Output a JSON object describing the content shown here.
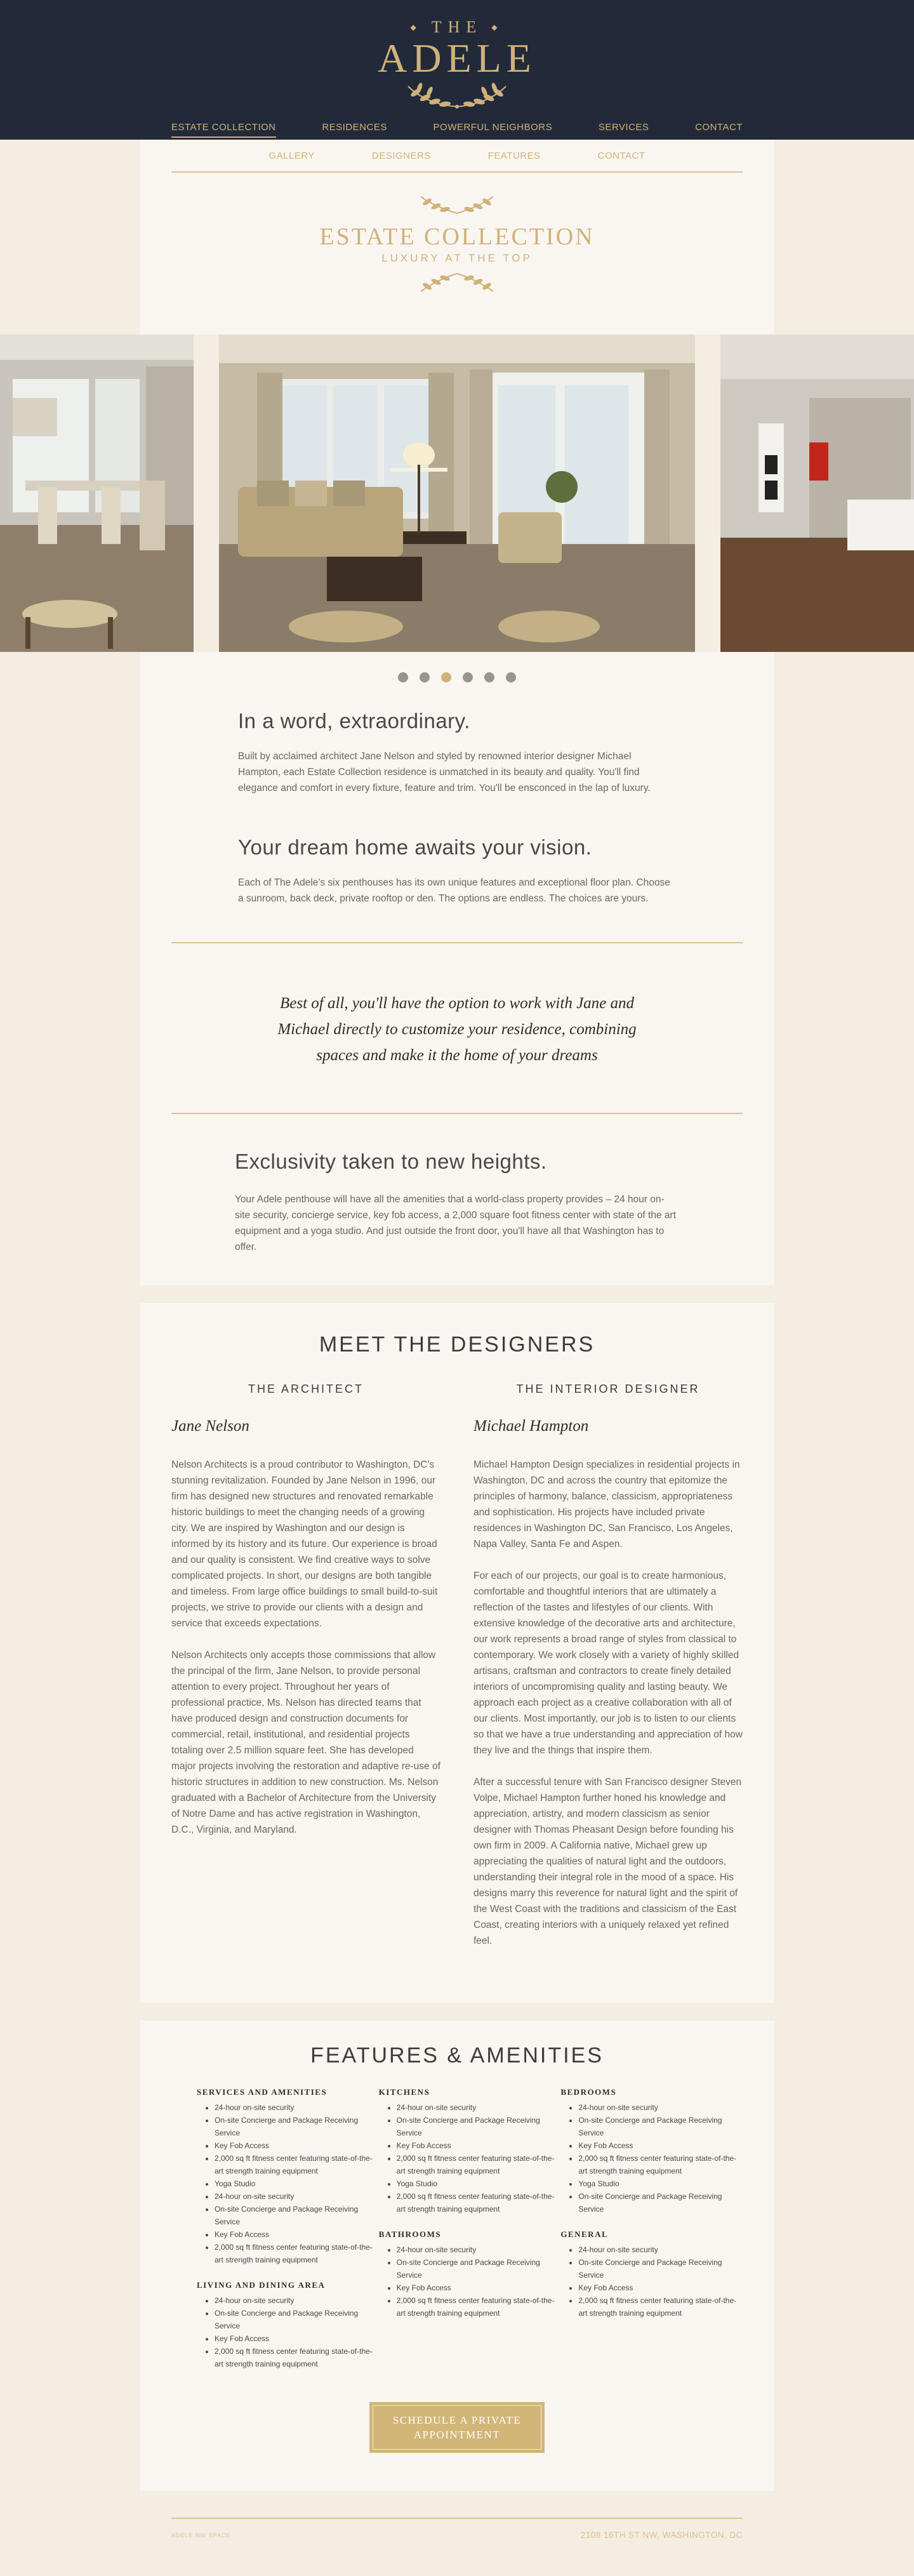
{
  "brand": {
    "the": "THE",
    "name": "ADELE"
  },
  "main_nav": [
    {
      "label": "ESTATE COLLECTION",
      "active": true
    },
    {
      "label": "RESIDENCES"
    },
    {
      "label": "POWERFUL NEIGHBORS"
    },
    {
      "label": "SERVICES"
    },
    {
      "label": "CONTACT"
    }
  ],
  "sub_nav": [
    "GALLERY",
    "DESIGNERS",
    "FEATURES",
    "CONTACT"
  ],
  "hero": {
    "title": "ESTATE COLLECTION",
    "subtitle": "LUXURY AT THE TOP"
  },
  "carousel": {
    "slide_count": 6,
    "active_index": 2
  },
  "intro": [
    {
      "heading": "In a word, extraordinary.",
      "body": "Built by acclaimed architect Jane Nelson and styled by renowned interior designer Michael Hampton, each Estate Collection residence is unmatched in its beauty and quality. You'll find elegance and comfort in every fixture, feature and trim. You'll be ensconced in the lap of luxury."
    },
    {
      "heading": "Your dream home awaits your vision.",
      "body": "Each of The Adele's six penthouses has its own unique features and exceptional floor plan. Choose a sunroom, back deck, private rooftop or den. The options are endless. The choices are yours."
    }
  ],
  "quote": "Best of all, you'll have the option to work with Jane and Michael directly to customize your residence, combining spaces and make it the home of your dreams",
  "exclusivity": {
    "heading": "Exclusivity taken to new heights.",
    "body": "Your Adele penthouse will have all the amenities that a world-class property provides – 24 hour on-site security, concierge service, key fob access, a 2,000 square foot fitness center with state of the art equipment and a yoga studio. And just outside the front door, you'll have all that Washington has to offer."
  },
  "designers": {
    "title": "MEET THE DESIGNERS",
    "architect": {
      "role": "THE ARCHITECT",
      "name": "Jane Nelson",
      "paragraphs": [
        "Nelson Architects is a proud contributor to Washington, DC's stunning revitalization. Founded by Jane Nelson in 1996, our firm has designed new structures and renovated remarkable historic buildings to meet the changing needs of a growing city. We are inspired by Washington and our design is informed by its history and its future. Our experience is broad and our quality is consistent. We find creative ways to solve complicated projects. In short, our designs are both tangible and timeless. From large office buildings to small build-to-suit projects, we strive to provide our clients with a design and service that exceeds expectations.",
        "Nelson Architects only accepts those commissions that allow the principal of the firm, Jane Nelson, to provide personal attention to every project. Throughout her years of professional practice, Ms. Nelson has directed teams that have produced design and construction documents for commercial, retail, institutional, and residential projects totaling over 2.5 million square feet. She has developed major projects involving the restoration and adaptive re-use of historic structures in addition to new construction. Ms. Nelson graduated with a Bachelor of Architecture from the University of Notre Dame and has active registration in Washington, D.C., Virginia, and Maryland."
      ]
    },
    "interior": {
      "role": "THE INTERIOR DESIGNER",
      "name": "Michael Hampton",
      "paragraphs": [
        "Michael Hampton Design specializes in residential projects in Washington, DC and across the country that epitomize the principles of harmony, balance, classicism, appropriateness and sophistication. His projects have included private residences in Washington DC, San Francisco, Los Angeles, Napa Valley, Santa Fe and Aspen.",
        "For each of our projects, our goal is to create harmonious, comfortable and thoughtful interiors that are ultimately a reflection of the tastes and lifestyles of our clients. With extensive knowledge of the decorative arts and architecture, our work represents a broad range of styles from classical to contemporary. We work closely with a variety of highly skilled artisans, craftsman and contractors to create finely detailed interiors of uncompromising quality and lasting beauty. We approach each project as a creative collaboration with all of our clients. Most importantly, our job is to listen to our clients so that we have a true understanding and appreciation of how they live and the things that inspire them.",
        "After a successful tenure with San Francisco designer Steven Volpe, Michael Hampton further honed his knowledge and appreciation, artistry, and modern classicism as senior designer with Thomas Pheasant Design before founding his own firm in 2009. A California native, Michael grew up appreciating the qualities of natural light and the outdoors, understanding their integral role in the mood of a space. His designs marry this reverence for natural light and the spirit of the West Coast with the traditions and classicism of the East Coast, creating interiors with a uniquely relaxed yet refined feel."
      ]
    }
  },
  "features": {
    "title": "FEATURES & AMENITIES",
    "columns": [
      [
        {
          "heading": "SERVICES AND AMENITIES",
          "items": [
            "24-hour on-site security",
            "On-site Concierge and Package Receiving Service",
            "Key Fob Access",
            "2,000 sq ft fitness center featuring state-of-the-art strength training equipment",
            "Yoga Studio",
            "24-hour on-site security",
            "On-site Concierge and Package Receiving Service",
            "Key Fob Access",
            "2,000 sq ft fitness center featuring state-of-the-art strength training equipment"
          ]
        },
        {
          "heading": "LIVING AND DINING AREA",
          "items": [
            "24-hour on-site security",
            "On-site Concierge and Package Receiving Service",
            "Key Fob Access",
            "2,000 sq ft fitness center featuring state-of-the-art strength training equipment"
          ]
        }
      ],
      [
        {
          "heading": "KITCHENS",
          "items": [
            "24-hour on-site security",
            "On-site Concierge and Package Receiving Service",
            "Key Fob Access",
            "2,000 sq ft fitness center featuring state-of-the-art strength training equipment",
            "Yoga Studio",
            "2,000 sq ft fitness center featuring state-of-the-art strength training equipment"
          ]
        },
        {
          "heading": "BATHROOMS",
          "items": [
            "24-hour on-site security",
            "On-site Concierge and Package Receiving Service",
            "Key Fob Access",
            "2,000 sq ft fitness center featuring state-of-the-art strength training equipment"
          ]
        }
      ],
      [
        {
          "heading": "BEDROOMS",
          "items": [
            "24-hour on-site security",
            "On-site Concierge and Package Receiving Service",
            "Key Fob Access",
            "2,000 sq ft fitness center featuring state-of-the-art strength training equipment",
            "Yoga Studio",
            "On-site Concierge and Package Receiving Service"
          ]
        },
        {
          "heading": "GENERAL",
          "items": [
            "24-hour on-site security",
            "On-site Concierge and Package Receiving Service",
            "Key Fob Access",
            "2,000 sq ft fitness center featuring state-of-the-art strength training equipment"
          ]
        }
      ]
    ],
    "cta": "SCHEDULE A PRIVATE APPOINTMENT"
  },
  "footer": {
    "small": "ADELE NW SPACE",
    "address": "2108 16TH ST NW, WASHINGTON, DC"
  },
  "colors": {
    "navy": "#222a3a",
    "gold": "#cfb27a",
    "cream": "#f3ede2",
    "panel": "#f9f6f1"
  }
}
